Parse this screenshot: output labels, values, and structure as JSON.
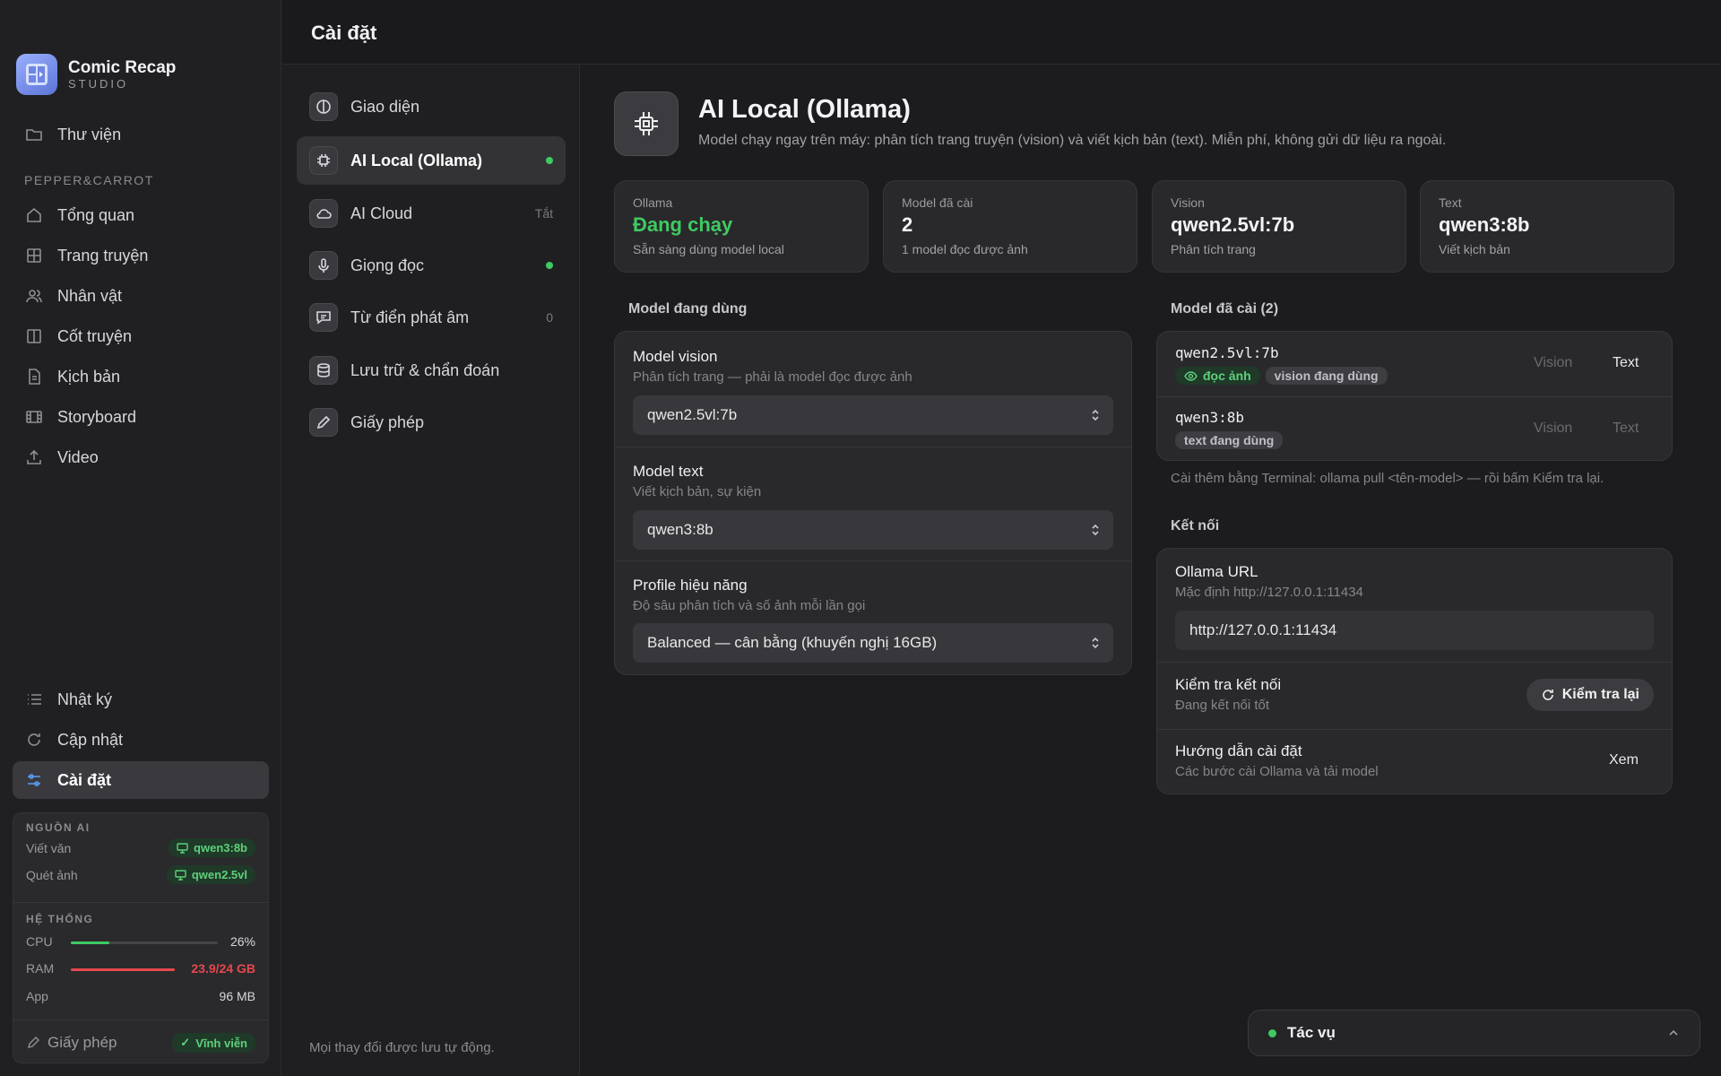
{
  "brand": {
    "name": "Comic Recap",
    "sub": "STUDIO"
  },
  "sidebar": {
    "library": "Thư viện",
    "project_label": "PEPPER&CARROT",
    "items": [
      "Tổng quan",
      "Trang truyện",
      "Nhân vật",
      "Cốt truyện",
      "Kịch bản",
      "Storyboard",
      "Video"
    ],
    "bottom_items": [
      "Nhật ký",
      "Cập nhật",
      "Cài đặt"
    ]
  },
  "status_panel": {
    "ai_head": "NGUỒN AI",
    "write_label": "Viết văn",
    "write_model": "qwen3:8b",
    "scan_label": "Quét ảnh",
    "scan_model": "qwen2.5vl",
    "sys_head": "HỆ THỐNG",
    "cpu_label": "CPU",
    "cpu_value": "26%",
    "cpu_fraction": 0.26,
    "ram_label": "RAM",
    "ram_value": "23.9/24 GB",
    "ram_fraction": 0.996,
    "app_label": "App",
    "app_value": "96 MB",
    "license_label": "Giấy phép",
    "license_value": "Vĩnh viễn"
  },
  "topbar": {
    "title": "Cài đặt"
  },
  "settings_nav": {
    "items": [
      {
        "label": "Giao diện",
        "tail": ""
      },
      {
        "label": "AI Local (Ollama)",
        "tail": ""
      },
      {
        "label": "AI Cloud",
        "tail": "Tắt"
      },
      {
        "label": "Giọng đọc",
        "tail": ""
      },
      {
        "label": "Từ điển phát âm",
        "tail": "0"
      },
      {
        "label": "Lưu trữ & chẩn đoán",
        "tail": ""
      },
      {
        "label": "Giấy phép",
        "tail": ""
      }
    ],
    "autosave": "Mọi thay đổi được lưu tự động."
  },
  "page": {
    "title": "AI Local (Ollama)",
    "description": "Model chạy ngay trên máy: phân tích trang truyện (vision) và viết kịch bản (text). Miễn phí, không gửi dữ liệu ra ngoài."
  },
  "stats": [
    {
      "label": "Ollama",
      "value": "Đang chạy",
      "sub": "Sẵn sàng dùng model local"
    },
    {
      "label": "Model đã cài",
      "value": "2",
      "sub": "1 model đọc được ảnh"
    },
    {
      "label": "Vision",
      "value": "qwen2.5vl:7b",
      "sub": "Phân tích trang"
    },
    {
      "label": "Text",
      "value": "qwen3:8b",
      "sub": "Viết kịch bản"
    }
  ],
  "active_models": {
    "heading": "Model đang dùng",
    "vision_title": "Model vision",
    "vision_sub": "Phân tích trang — phải là model đọc được ảnh",
    "vision_value": "qwen2.5vl:7b",
    "text_title": "Model text",
    "text_sub": "Viết kịch bản, sự kiện",
    "text_value": "qwen3:8b",
    "profile_title": "Profile hiệu năng",
    "profile_sub": "Độ sâu phân tích và số ảnh mỗi lần gọi",
    "profile_value": "Balanced — cân bằng (khuyến nghị 16GB)"
  },
  "installed": {
    "heading": "Model đã cài (2)",
    "models": [
      {
        "name": "qwen2.5vl:7b",
        "tag1": "đọc ảnh",
        "tag2": "vision đang dùng",
        "vision": "Vision",
        "text": "Text"
      },
      {
        "name": "qwen3:8b",
        "tag1": "text đang dùng",
        "vision": "Vision",
        "text": "Text"
      }
    ],
    "hint": "Cài thêm bằng Terminal: ollama pull <tên-model> — rồi bấm Kiểm tra lại."
  },
  "connection": {
    "heading": "Kết nối",
    "url_title": "Ollama URL",
    "url_sub": "Mặc định http://127.0.0.1:11434",
    "url_value": "http://127.0.0.1:11434",
    "check_title": "Kiểm tra kết nối",
    "check_sub": "Đang kết nối tốt",
    "check_btn": "Kiểm tra lại",
    "guide_title": "Hướng dẫn cài đặt",
    "guide_sub": "Các bước cài Ollama và tải model",
    "guide_btn": "Xem"
  },
  "tasks": {
    "label": "Tác vụ"
  },
  "colors": {
    "accent_green": "#3fca62",
    "ram_red": "#e5484d",
    "active_blue": "#5b9cf5"
  }
}
